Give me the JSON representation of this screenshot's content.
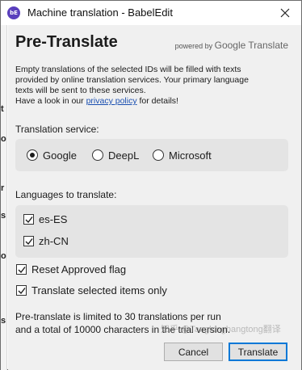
{
  "window": {
    "app_icon_text": "bE",
    "title": "Machine translation - BabelEdit",
    "close_icon": "close-icon"
  },
  "background": {
    "fragments": [
      "t",
      "o",
      "r",
      "s",
      "o",
      "s"
    ]
  },
  "header": {
    "heading": "Pre-Translate",
    "powered_by_prefix": "powered by ",
    "powered_by_brand": "Google Translate"
  },
  "intro": {
    "line1": "Empty translations of the selected IDs will be filled with texts",
    "line2": "provided by online translation services. Your primary language",
    "line3": "texts will be sent to these services.",
    "line4_prefix": "Have a look in our ",
    "privacy_link": "privacy policy",
    "line4_suffix": " for details!"
  },
  "service": {
    "label": "Translation service:",
    "options": [
      {
        "label": "Google",
        "selected": true
      },
      {
        "label": "DeepL",
        "selected": false
      },
      {
        "label": "Microsoft",
        "selected": false
      }
    ]
  },
  "languages": {
    "label": "Languages to translate:",
    "items": [
      {
        "label": "es-ES",
        "checked": true
      },
      {
        "label": "zh-CN",
        "checked": true
      }
    ]
  },
  "options": {
    "reset_approved": {
      "label": "Reset Approved flag",
      "checked": true
    },
    "translate_selected": {
      "label": "Translate selected items only",
      "checked": true
    }
  },
  "note": {
    "line1": "Pre-translate is limited to 30 translations per run",
    "line2": "and a total of 10000 characters in the trial version."
  },
  "buttons": {
    "cancel": "Cancel",
    "translate": "Translate"
  },
  "watermark": "知乎 @Tanglongbangtong翻译"
}
